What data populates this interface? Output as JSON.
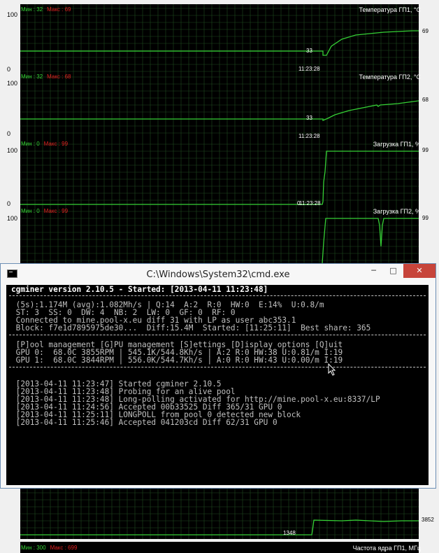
{
  "graphs": [
    {
      "title": "Температура ГП1, °C",
      "min_label": "Мин : 32",
      "max_label": "Макс : 69",
      "y_max": "100",
      "y_min": "0",
      "time": "11:23:28",
      "start_value": "33",
      "current_value": "69"
    },
    {
      "title": "Температура ГП2, °C",
      "min_label": "Мин : 32",
      "max_label": "Макс : 68",
      "y_max": "100",
      "y_min": "0",
      "time": "11:23:28",
      "start_value": "33",
      "current_value": "68"
    },
    {
      "title": "Загрузка ГП1, %",
      "min_label": "Мин : 0",
      "max_label": "Макс : 99",
      "y_max": "100",
      "y_min": "0",
      "time": "11:23:28",
      "start_value": "0",
      "current_value": "99"
    },
    {
      "title": "Загрузка ГП2, %",
      "min_label": "Мин : 0",
      "max_label": "Макс : 99",
      "y_max": "100",
      "y_min": "",
      "time": "",
      "start_value": "",
      "current_value": "99"
    },
    {
      "title": "",
      "min_label": "",
      "max_label": "",
      "y_max": "",
      "y_min": "",
      "time": "",
      "start_value": "1348",
      "current_value": "3852"
    }
  ],
  "bottom_partial": {
    "min_label": "Мин : 300",
    "max_label": "Макс : 699",
    "title": "Частота ядра ГП1, МГц"
  },
  "cmd": {
    "title": "C:\\Windows\\System32\\cmd.exe",
    "minimize": "─",
    "maximize": "□",
    "close": "✕",
    "header": "cgminer version 2.10.5 - Started: [2013-04-11 11:23:48]",
    "status_lines": [
      " (5s):1.174M (avg):1.082Mh/s | Q:14  A:2  R:0  HW:0  E:14%  U:0.8/m",
      " ST: 3  SS: 0  DW: 4  NB: 2  LW: 0  GF: 0  RF: 0",
      " Connected to mine.pool-x.eu diff 31 with LP as user abc353.1",
      " Block: f7e1d7895975de30...  Diff:15.4M  Started: [11:25:11]  Best share: 365"
    ],
    "device_lines": [
      " [P]ool management [G]PU management [S]ettings [D]isplay options [Q]uit",
      " GPU 0:  68.0C 3855RPM | 545.1K/544.8Kh/s | A:2 R:0 HW:38 U:0.81/m I:19",
      " GPU 1:  68.0C 3844RPM | 556.0K/544.7Kh/s | A:0 R:0 HW:43 U:0.00/m I:19"
    ],
    "log_lines": [
      " [2013-04-11 11:23:47] Started cgminer 2.10.5",
      " [2013-04-11 11:23:48] Probing for an alive pool",
      " [2013-04-11 11:23:48] Long-polling activated for http://mine.pool-x.eu:8337/LP",
      " [2013-04-11 11:24:56] Accepted 00b33525 Diff 365/31 GPU 0",
      " [2013-04-11 11:25:11] LONGPOLL from pool 0 detected new block",
      " [2013-04-11 11:25:46] Accepted 041203cd Diff 62/31 GPU 0"
    ]
  },
  "colors": {
    "graph_line": "#35d035",
    "grid": "#1f4a1f",
    "min_text": "#35d035",
    "max_text": "#e02020",
    "close_button": "#c7443a"
  }
}
